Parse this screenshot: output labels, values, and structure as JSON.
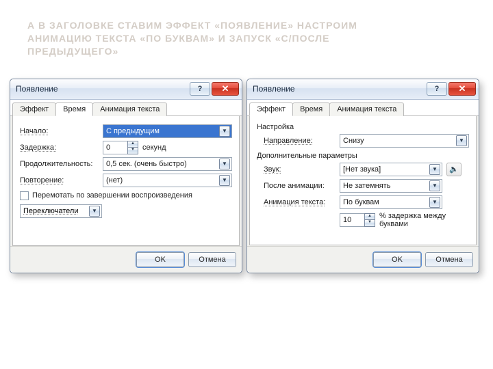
{
  "page_title_lines": "А В ЗАГОЛОВКЕ СТАВИМ ЭФФЕКТ «ПОЯВЛЕНИЕ» НАСТРОИМ\nАНИМАЦИЮ ТЕКСТА «ПО БУКВАМ» И ЗАПУСК «С/ПОСЛЕ\nПРЕДЫДУЩЕГО»",
  "dlg1": {
    "title": "Появление",
    "tabs": {
      "effect": "Эффект",
      "time": "Время",
      "textanim": "Анимация текста"
    },
    "labels": {
      "start": "Начало:",
      "delay": "Задержка:",
      "duration": "Продолжительность:",
      "repeat": "Повторение:",
      "rewind": "Перемотать по завершении воспроизведения",
      "switches": "Переключатели",
      "seconds": "секунд"
    },
    "values": {
      "start": "С предыдущим",
      "delay": "0",
      "duration": "0,5 сек. (очень быстро)",
      "repeat": "(нет)"
    },
    "buttons": {
      "ok": "OK",
      "cancel": "Отмена"
    }
  },
  "dlg2": {
    "title": "Появление",
    "tabs": {
      "effect": "Эффект",
      "time": "Время",
      "textanim": "Анимация текста"
    },
    "sections": {
      "settings": "Настройка",
      "extra": "Дополнительные параметры"
    },
    "labels": {
      "direction": "Направление:",
      "sound": "Звук:",
      "afteranim": "После анимации:",
      "textanim": "Анимация текста:",
      "percent_delay": "% задержка между буквами"
    },
    "values": {
      "direction": "Снизу",
      "sound": "[Нет звука]",
      "afteranim": "Не затемнять",
      "textanim": "По буквам",
      "percent": "10"
    },
    "buttons": {
      "ok": "OK",
      "cancel": "Отмена"
    }
  }
}
